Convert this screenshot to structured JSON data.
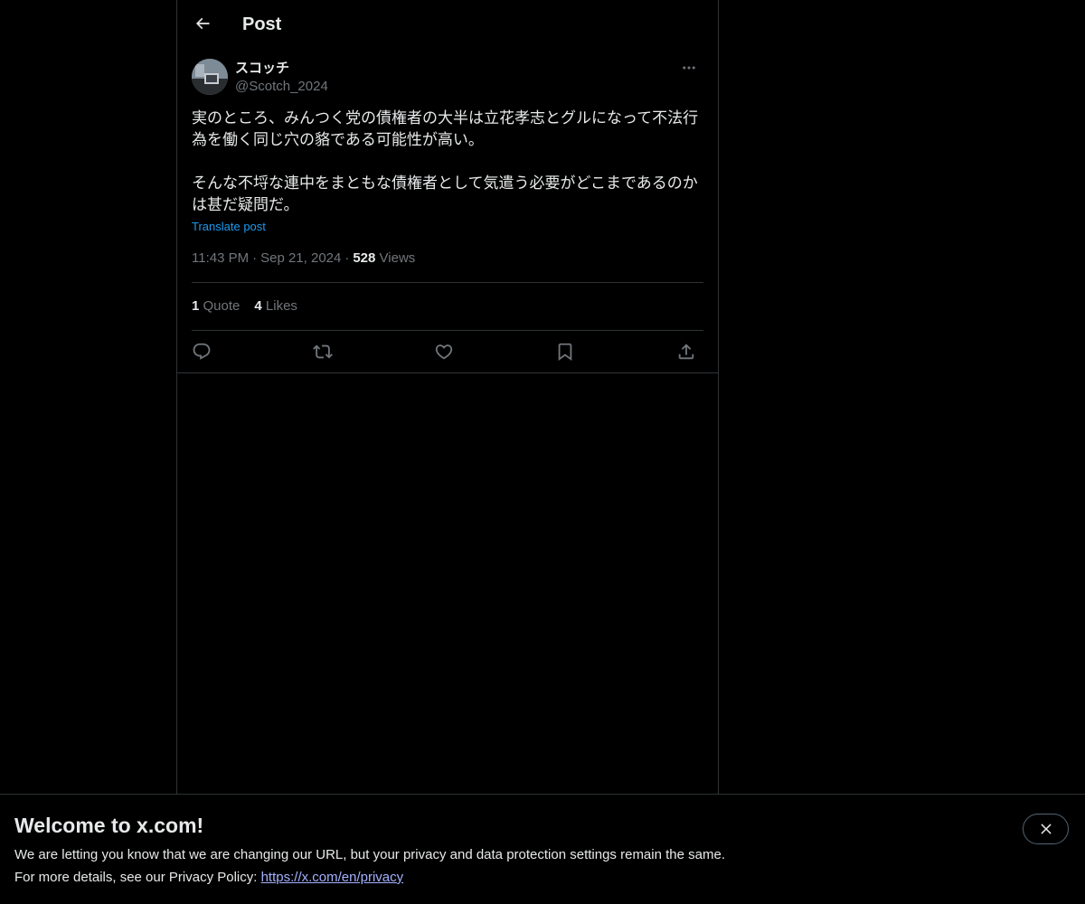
{
  "header": {
    "title": "Post",
    "back_icon": "arrow-left-icon"
  },
  "author": {
    "display_name": "スコッチ",
    "handle": "@Scotch_2024",
    "avatar_icon": "avatar"
  },
  "post": {
    "paragraph_1": "実のところ、みんつく党の債権者の大半は立花孝志とグルになって不法行為を働く同じ穴の貉である可能性が高い。",
    "paragraph_2": "そんな不埒な連中をまともな債権者として気遣う必要がどこまであるのかは甚だ疑問だ。",
    "translate_label": "Translate post",
    "time": "11:43 PM",
    "date": "Sep 21, 2024",
    "separator": "·",
    "views_count": "528",
    "views_label": "Views"
  },
  "stats": {
    "quotes_count": "1",
    "quotes_label": "Quote",
    "likes_count": "4",
    "likes_label": "Likes"
  },
  "actions": [
    "reply-icon",
    "repost-icon",
    "like-icon",
    "bookmark-icon",
    "share-icon"
  ],
  "banner": {
    "title": "Welcome to x.com!",
    "line1": "We are letting you know that we are changing our URL, but your privacy and data protection settings remain the same.",
    "line2_prefix": "For more details, see our Privacy Policy: ",
    "link_text": "https://x.com/en/privacy",
    "close_icon": "close-icon"
  },
  "colors": {
    "background": "#000000",
    "text": "#e7e9ea",
    "muted": "#71767b",
    "accent": "#1d9bf0",
    "border": "#2f3336",
    "link": "#a4b1ff"
  }
}
